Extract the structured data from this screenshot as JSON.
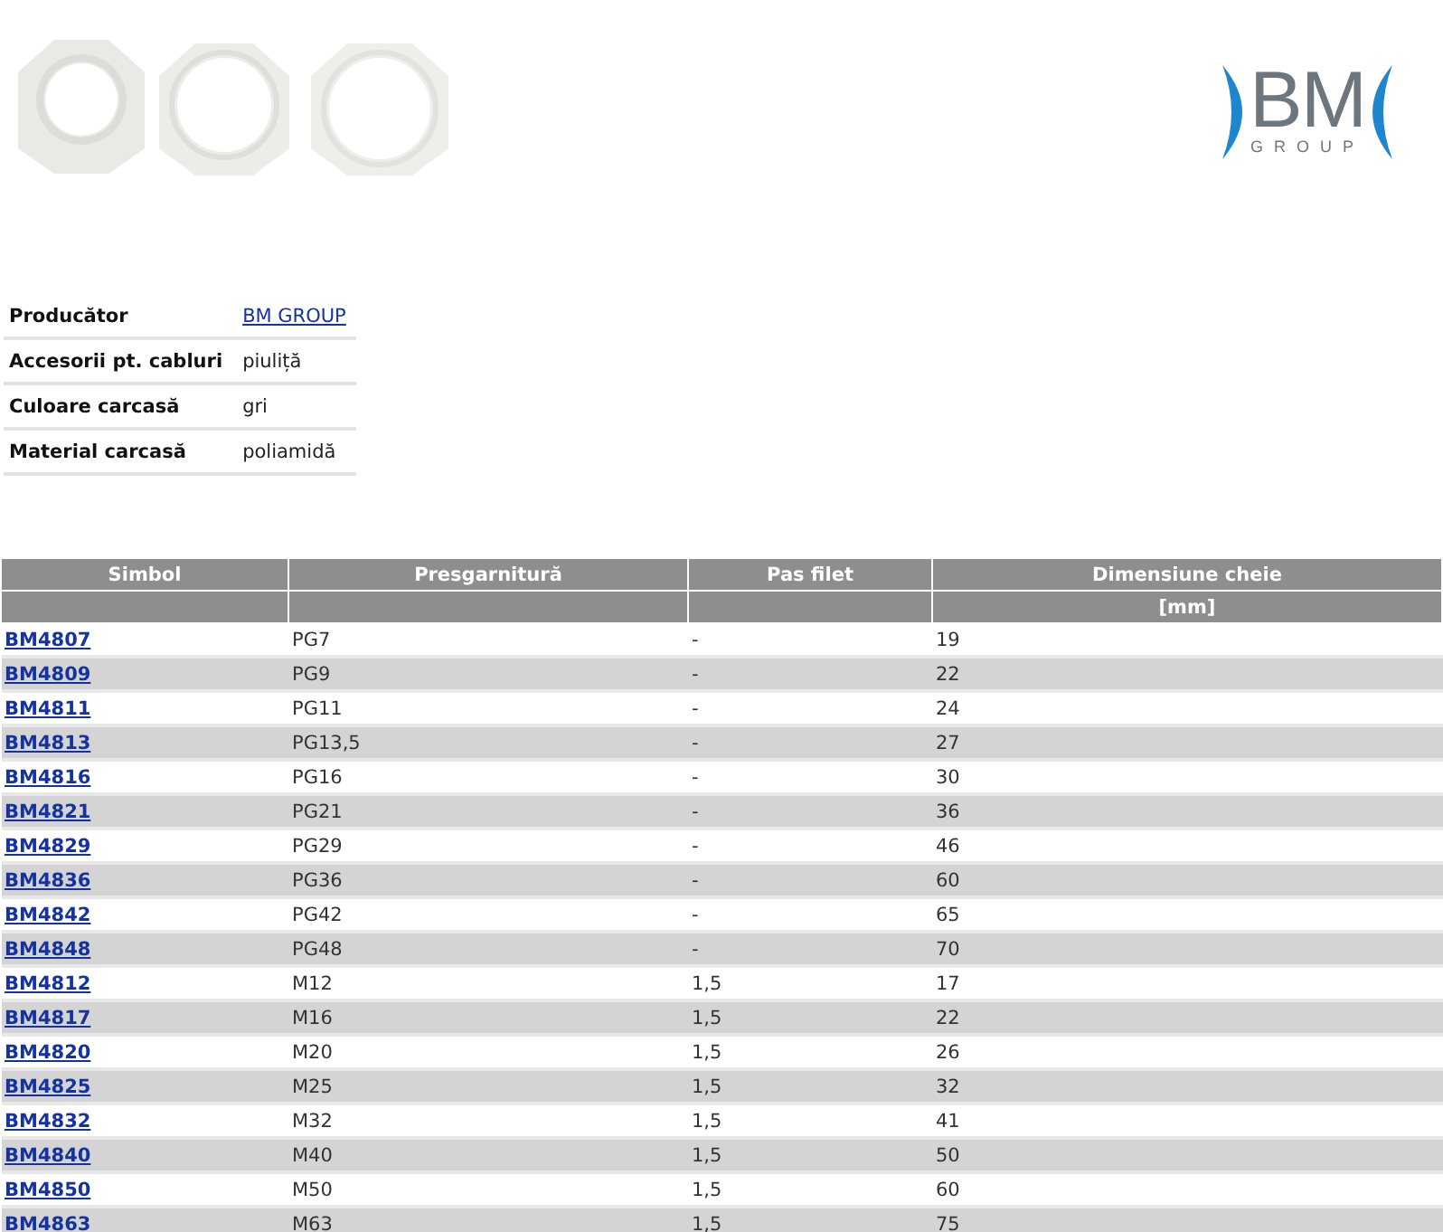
{
  "header": {
    "logo": {
      "main": "BM",
      "sub": "GROUP"
    }
  },
  "properties": [
    {
      "label": "Producător",
      "value": "BM GROUP",
      "link": true
    },
    {
      "label": "Accesorii pt. cabluri",
      "value": "piuliță",
      "link": false
    },
    {
      "label": "Culoare carcasă",
      "value": "gri",
      "link": false
    },
    {
      "label": "Material carcasă",
      "value": "poliamidă",
      "link": false
    }
  ],
  "table": {
    "columns": [
      {
        "title": "Simbol"
      },
      {
        "title": "Presgarnitură"
      },
      {
        "title": "Pas filet"
      },
      {
        "title": "Dimensiune cheie",
        "unit": "[mm]"
      }
    ],
    "rows": [
      [
        "BM4807",
        "PG7",
        "-",
        "19"
      ],
      [
        "BM4809",
        "PG9",
        "-",
        "22"
      ],
      [
        "BM4811",
        "PG11",
        "-",
        "24"
      ],
      [
        "BM4813",
        "PG13,5",
        "-",
        "27"
      ],
      [
        "BM4816",
        "PG16",
        "-",
        "30"
      ],
      [
        "BM4821",
        "PG21",
        "-",
        "36"
      ],
      [
        "BM4829",
        "PG29",
        "-",
        "46"
      ],
      [
        "BM4836",
        "PG36",
        "-",
        "60"
      ],
      [
        "BM4842",
        "PG42",
        "-",
        "65"
      ],
      [
        "BM4848",
        "PG48",
        "-",
        "70"
      ],
      [
        "BM4812",
        "M12",
        "1,5",
        "17"
      ],
      [
        "BM4817",
        "M16",
        "1,5",
        "22"
      ],
      [
        "BM4820",
        "M20",
        "1,5",
        "26"
      ],
      [
        "BM4825",
        "M25",
        "1,5",
        "32"
      ],
      [
        "BM4832",
        "M32",
        "1,5",
        "41"
      ],
      [
        "BM4840",
        "M40",
        "1,5",
        "50"
      ],
      [
        "BM4850",
        "M50",
        "1,5",
        "60"
      ],
      [
        "BM4863",
        "M63",
        "1,5",
        "75"
      ]
    ]
  }
}
